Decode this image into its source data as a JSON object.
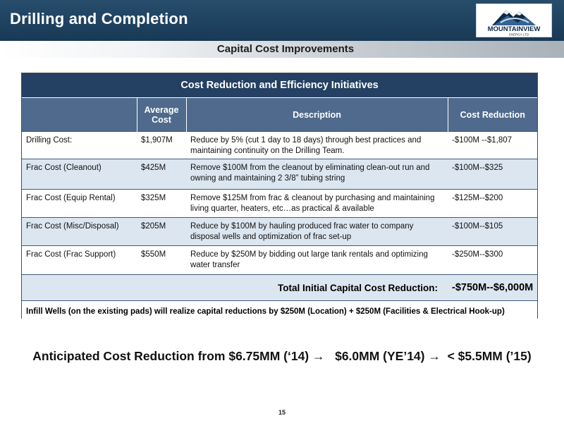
{
  "header": {
    "title": "Drilling and Completion",
    "logo_text": "MOUNTAINVIEW",
    "logo_subtext": "ENERGY LTD"
  },
  "subtitle": "Capital Cost Improvements",
  "table": {
    "title": "Cost Reduction and Efficiency Initiatives",
    "columns": [
      "",
      "Average Cost",
      "Description",
      "Cost Reduction"
    ],
    "rows": [
      {
        "item": "Drilling Cost:",
        "avg_cost": "$1,907M",
        "description": "Reduce by 5% (cut 1 day to 18 days) through best practices and maintaining continuity on the Drilling Team.",
        "reduction": "-$100M --$1,807"
      },
      {
        "item": "Frac Cost (Cleanout)",
        "avg_cost": "$425M",
        "description": "Remove $100M from the cleanout by eliminating clean-out run and owning and maintaining 2 3/8” tubing string",
        "reduction": "-$100M--$325"
      },
      {
        "item": "Frac Cost (Equip Rental)",
        "avg_cost": "$325M",
        "description": "Remove $125M from frac & cleanout by purchasing and maintaining living quarter, heaters, etc…as practical & available",
        "reduction": "-$125M--$200"
      },
      {
        "item": "Frac Cost (Misc/Disposal)",
        "avg_cost": "$205M",
        "description": "Reduce by $100M by hauling produced frac water to company disposal wells and optimization of frac set-up",
        "reduction": "-$100M--$105"
      },
      {
        "item": "Frac Cost (Frac Support)",
        "avg_cost": "$550M",
        "description": "Reduce by $250M by bidding out large tank rentals and optimizing water transfer",
        "reduction": "-$250M--$300"
      }
    ],
    "total_label": "Total Initial Capital Cost Reduction:",
    "total_value": "-$750M--$6,000M",
    "footer": "Infill Wells (on the existing pads) will realize capital reductions by $250M (Location) + $250M (Facilities & Electrical Hook-up)"
  },
  "anticipated": "Anticipated Cost Reduction from $6.75MM (‘14) →   $6.0MM (YE’14) →  < $5.5MM (’15)",
  "page_number": "15",
  "colors": {
    "header_bg": "#1e4260",
    "table_title_bg": "#244062",
    "table_header_bg": "#4f6a8c",
    "row_shade": "#dce6f1"
  }
}
